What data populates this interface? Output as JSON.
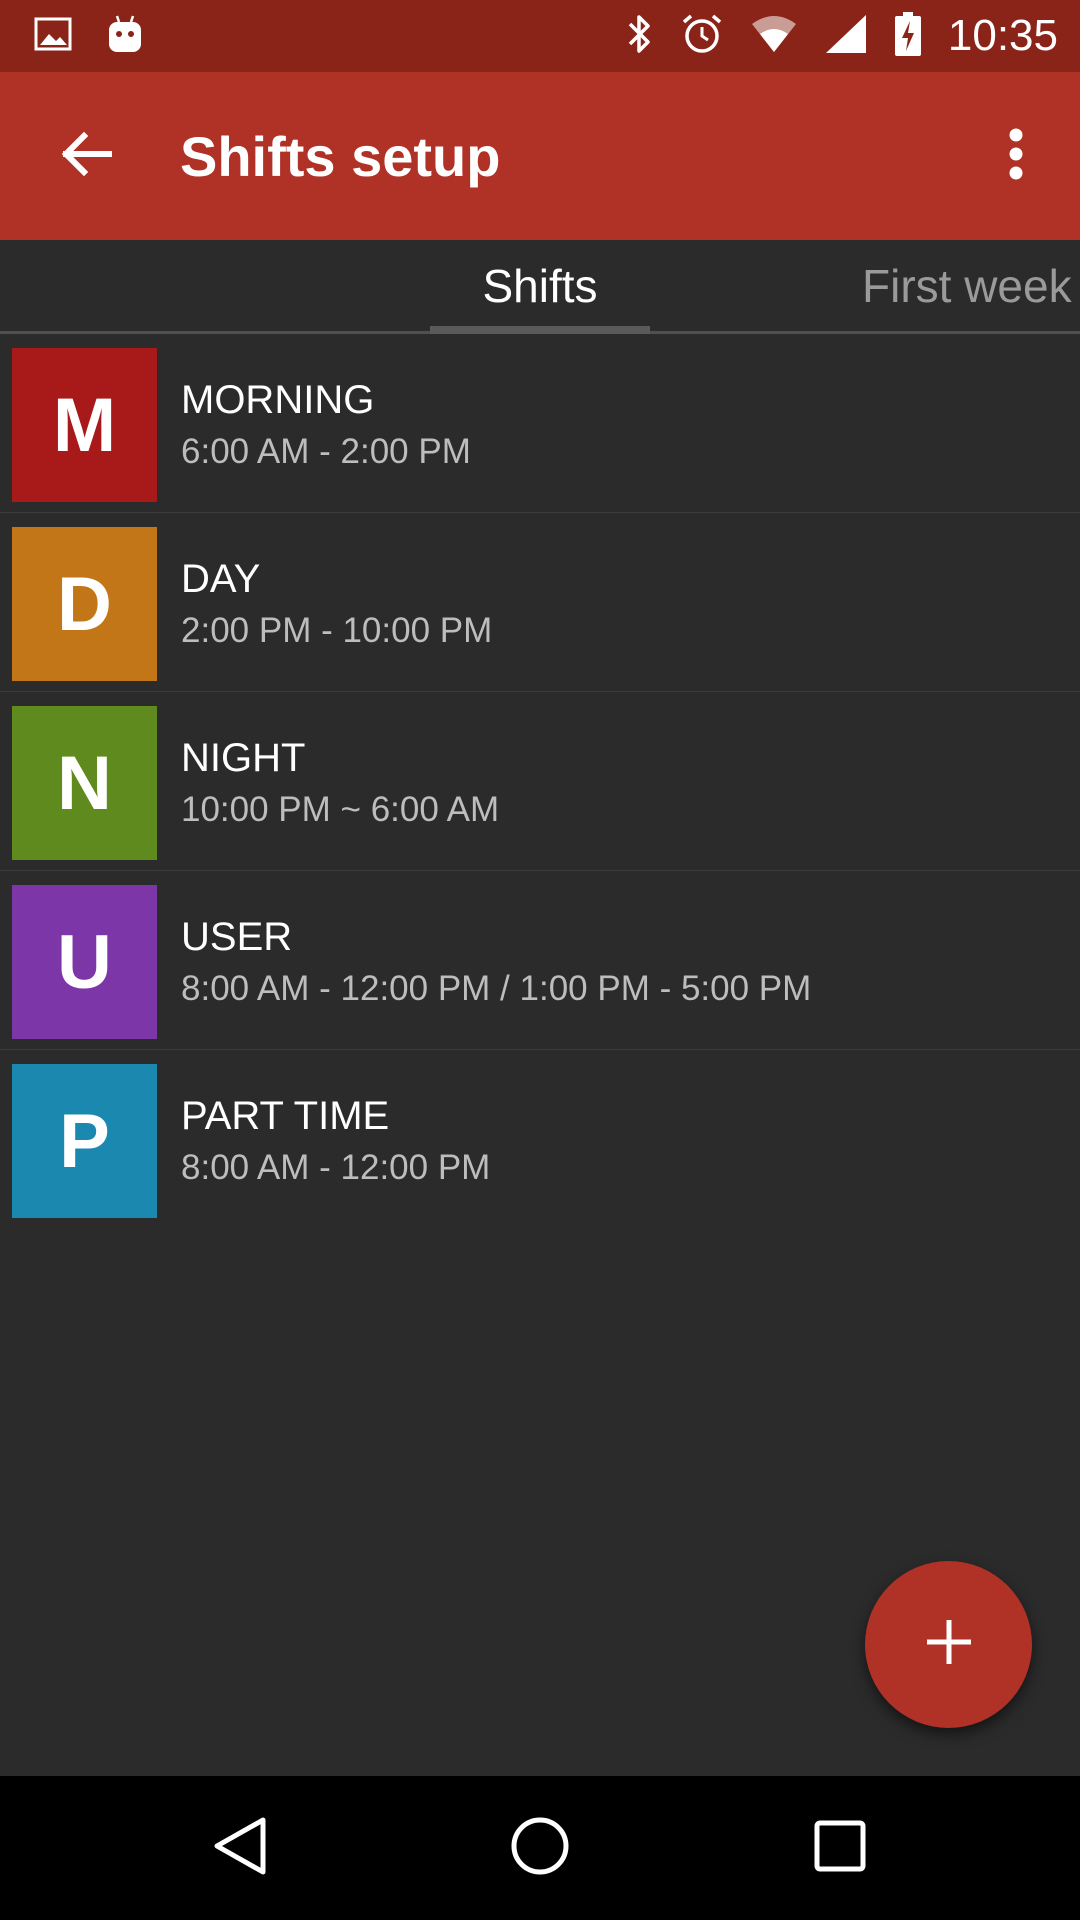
{
  "status_bar": {
    "time": "10:35",
    "left_icons": [
      "image-icon",
      "android-icon"
    ],
    "right_icons": [
      "bluetooth-icon",
      "alarm-icon",
      "wifi-icon",
      "cell-signal-icon",
      "battery-charging-icon"
    ]
  },
  "app_bar": {
    "title": "Shifts setup",
    "back_icon": "arrow-back-icon",
    "menu_icon": "more-vert-icon",
    "color": "#b03226"
  },
  "tabs": [
    {
      "label": "Shifts",
      "selected": true
    },
    {
      "label": "First week",
      "selected": false
    }
  ],
  "shifts": [
    {
      "letter": "M",
      "name": "MORNING",
      "time": "6:00 AM - 2:00 PM",
      "color": "#a8191a"
    },
    {
      "letter": "D",
      "name": "DAY",
      "time": "2:00 PM - 10:00 PM",
      "color": "#c27617"
    },
    {
      "letter": "N",
      "name": "NIGHT",
      "time": "10:00 PM ~ 6:00 AM",
      "color": "#5e8a1e"
    },
    {
      "letter": "U",
      "name": "USER",
      "time": "8:00 AM - 12:00 PM / 1:00 PM - 5:00 PM",
      "color": "#7d36a8"
    },
    {
      "letter": "P",
      "name": "PART TIME",
      "time": "8:00 AM - 12:00 PM",
      "color": "#1b88b0"
    }
  ],
  "fab": {
    "icon": "plus-icon",
    "color": "#b03226"
  },
  "nav_bar": {
    "icons": [
      "nav-back-icon",
      "nav-home-icon",
      "nav-recents-icon"
    ]
  }
}
